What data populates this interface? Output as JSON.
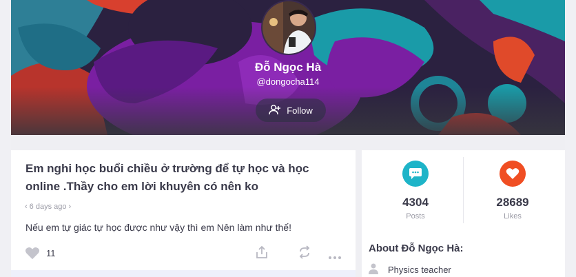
{
  "profile": {
    "name": "Đỗ Ngọc Hà",
    "handle": "@dongocha114",
    "follow_label": "Follow"
  },
  "post": {
    "title": "Em nghi học buổi chiều ở trường để tự học và học online .Thầy cho em lời khuyên có nên ko",
    "time": "6 days ago",
    "body": "Nếu em tự giác tự học được như vậy thì em Nên làm như thế!",
    "likes": "11"
  },
  "stats": {
    "posts_count": "4304",
    "posts_label": "Posts",
    "likes_count": "28689",
    "likes_label": "Likes"
  },
  "about": {
    "title": "About Đỗ Ngọc Hà:",
    "occupation": "Physics teacher"
  },
  "colors": {
    "posts_accent": "#1eb4c8",
    "likes_accent": "#f04e23",
    "banner_purple": "#7a1fa2",
    "banner_teal": "#1a9ba8",
    "banner_red": "#c8362e"
  },
  "icons": {
    "follow": "add-user-icon",
    "posts": "chat-bubble-icon",
    "likes": "heart-icon",
    "share": "share-icon",
    "repost": "repost-icon",
    "more": "more-dots-icon",
    "about": "person-icon"
  }
}
